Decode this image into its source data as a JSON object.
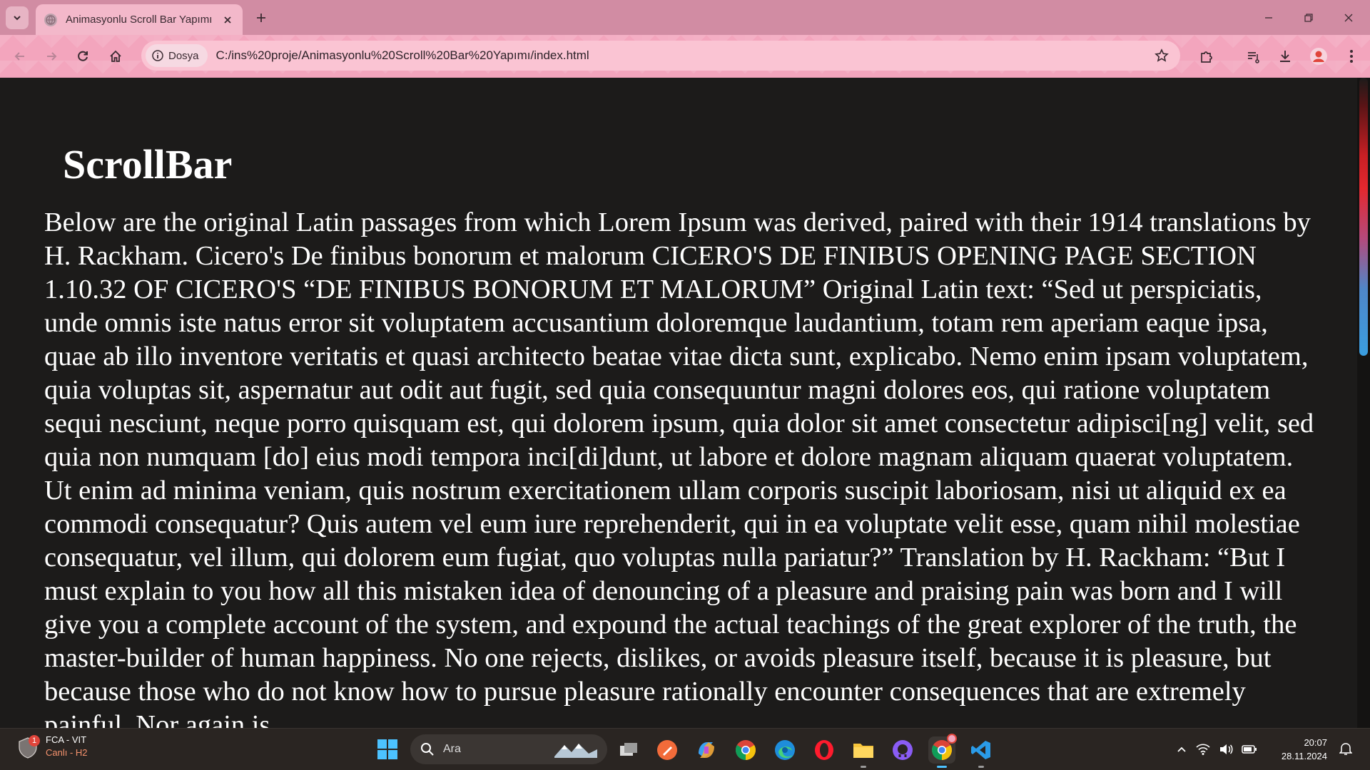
{
  "browser": {
    "tab_title": "Animasyonlu Scroll Bar Yapımı",
    "site_chip_label": "Dosya",
    "url": "C:/ins%20proje/Animasyonlu%20Scroll%20Bar%20Yapımı/index.html",
    "theme_color": "#f3a5bd"
  },
  "page": {
    "heading": "ScrollBar",
    "body_text": "Below are the original Latin passages from which Lorem Ipsum was derived, paired with their 1914 translations by H. Rackham. Cicero's De finibus bonorum et malorum CICERO'S DE FINIBUS OPENING PAGE SECTION 1.10.32 OF CICERO'S “DE FINIBUS BONORUM ET MALORUM” Original Latin text: “Sed ut perspiciatis, unde omnis iste natus error sit voluptatem accusantium doloremque laudantium, totam rem aperiam eaque ipsa, quae ab illo inventore veritatis et quasi architecto beatae vitae dicta sunt, explicabo. Nemo enim ipsam voluptatem, quia voluptas sit, aspernatur aut odit aut fugit, sed quia consequuntur magni dolores eos, qui ratione voluptatem sequi nesciunt, neque porro quisquam est, qui dolorem ipsum, quia dolor sit amet consectetur adipisci[ng] velit, sed quia non numquam [do] eius modi tempora inci[di]dunt, ut labore et dolore magnam aliquam quaerat voluptatem. Ut enim ad minima veniam, quis nostrum exercitationem ullam corporis suscipit laboriosam, nisi ut aliquid ex ea commodi consequatur? Quis autem vel eum iure reprehenderit, qui in ea voluptate velit esse, quam nihil molestiae consequatur, vel illum, qui dolorem eum fugiat, quo voluptas nulla pariatur?” Translation by H. Rackham: “But I must explain to you how all this mistaken idea of denouncing of a pleasure and praising pain was born and I will give you a complete account of the system, and expound the actual teachings of the great explorer of the truth, the master-builder of human happiness. No one rejects, dislikes, or avoids pleasure itself, because it is pleasure, but because those who do not know how to pursue pleasure rationally encounter consequences that are extremely painful. Nor again is",
    "scroll_position": 0.0,
    "background_color": "#1c1b1a"
  },
  "taskbar": {
    "weather_badge": "1",
    "weather_title": "FCA - VIT",
    "weather_subtitle": "Canlı - H2",
    "search_label": "Ara",
    "apps": [
      "task-view",
      "bing-sketch",
      "copilot",
      "chrome",
      "edge",
      "opera",
      "file-explorer",
      "github-desktop",
      "chrome-profile",
      "vscode"
    ],
    "clock_time": "20:07",
    "clock_date": "28.11.2024"
  }
}
